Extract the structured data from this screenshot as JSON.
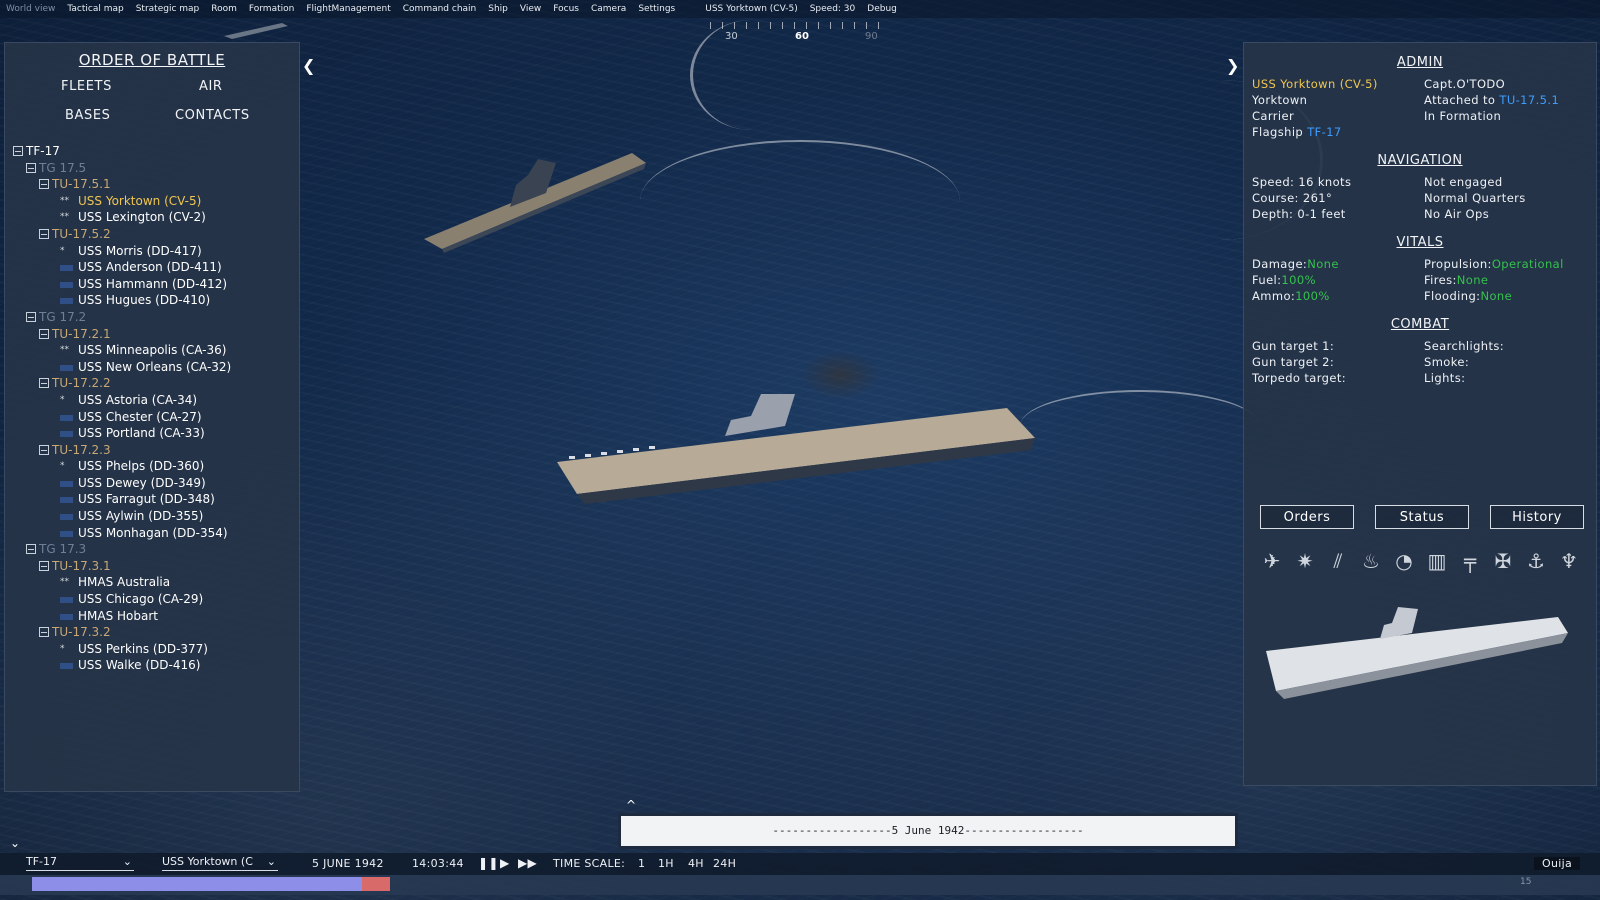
{
  "menu": {
    "items": [
      "World view",
      "Tactical map",
      "Strategic map",
      "Room",
      "Formation",
      "FlightManagement",
      "Command chain",
      "Ship",
      "View",
      "Focus",
      "Camera",
      "Settings"
    ],
    "status_ship": "USS Yorktown (CV-5)",
    "status_speed": "Speed: 30",
    "debug": "Debug"
  },
  "compass": {
    "labels": [
      "30",
      "60",
      "90"
    ]
  },
  "oob": {
    "title": "ORDER OF BATTLE",
    "tabs": [
      "FLEETS",
      "AIR",
      "BASES",
      "CONTACTS"
    ],
    "tree": [
      {
        "level": 0,
        "type": "tf",
        "label": "TF-17",
        "box": true
      },
      {
        "level": 1,
        "type": "tg",
        "label": "TG 17.5",
        "box": true
      },
      {
        "level": 2,
        "type": "tu",
        "label": "TU-17.5.1",
        "box": true
      },
      {
        "level": 3,
        "type": "ship",
        "label": "USS Yorktown (CV-5)",
        "flag": "**",
        "selected": true
      },
      {
        "level": 3,
        "type": "ship",
        "label": "USS Lexington (CV-2)",
        "flag": "**"
      },
      {
        "level": 2,
        "type": "tu",
        "label": "TU-17.5.2",
        "box": true
      },
      {
        "level": 3,
        "type": "ship",
        "label": "USS Morris (DD-417)",
        "flag": "*"
      },
      {
        "level": 3,
        "type": "ship",
        "label": "USS Anderson (DD-411)",
        "flag": "bar"
      },
      {
        "level": 3,
        "type": "ship",
        "label": "USS Hammann (DD-412)",
        "flag": "bar"
      },
      {
        "level": 3,
        "type": "ship",
        "label": "USS Hugues (DD-410)",
        "flag": "bar"
      },
      {
        "level": 1,
        "type": "tg",
        "label": "TG 17.2",
        "box": true
      },
      {
        "level": 2,
        "type": "tu",
        "label": "TU-17.2.1",
        "box": true
      },
      {
        "level": 3,
        "type": "ship",
        "label": "USS Minneapolis (CA-36)",
        "flag": "**"
      },
      {
        "level": 3,
        "type": "ship",
        "label": "USS New Orleans (CA-32)",
        "flag": "bar"
      },
      {
        "level": 2,
        "type": "tu",
        "label": "TU-17.2.2",
        "box": true
      },
      {
        "level": 3,
        "type": "ship",
        "label": "USS Astoria (CA-34)",
        "flag": "*"
      },
      {
        "level": 3,
        "type": "ship",
        "label": "USS Chester (CA-27)",
        "flag": "bar"
      },
      {
        "level": 3,
        "type": "ship",
        "label": "USS Portland (CA-33)",
        "flag": "bar"
      },
      {
        "level": 2,
        "type": "tu",
        "label": "TU-17.2.3",
        "box": true
      },
      {
        "level": 3,
        "type": "ship",
        "label": "USS Phelps (DD-360)",
        "flag": "*"
      },
      {
        "level": 3,
        "type": "ship",
        "label": "USS Dewey (DD-349)",
        "flag": "bar"
      },
      {
        "level": 3,
        "type": "ship",
        "label": "USS Farragut (DD-348)",
        "flag": "bar"
      },
      {
        "level": 3,
        "type": "ship",
        "label": "USS Aylwin (DD-355)",
        "flag": "bar"
      },
      {
        "level": 3,
        "type": "ship",
        "label": "USS Monhagan (DD-354)",
        "flag": "bar"
      },
      {
        "level": 1,
        "type": "tg",
        "label": "TG 17.3",
        "box": true
      },
      {
        "level": 2,
        "type": "tu",
        "label": "TU-17.3.1",
        "box": true
      },
      {
        "level": 3,
        "type": "ship",
        "label": "HMAS Australia",
        "flag": "**"
      },
      {
        "level": 3,
        "type": "ship",
        "label": "USS Chicago (CA-29)",
        "flag": "bar"
      },
      {
        "level": 3,
        "type": "ship",
        "label": "HMAS Hobart",
        "flag": "bar"
      },
      {
        "level": 2,
        "type": "tu",
        "label": "TU-17.3.2",
        "box": true
      },
      {
        "level": 3,
        "type": "ship",
        "label": "USS Perkins (DD-377)",
        "flag": "*"
      },
      {
        "level": 3,
        "type": "ship",
        "label": "USS Walke (DD-416)",
        "flag": "bar"
      }
    ]
  },
  "details": {
    "admin_title": "ADMIN",
    "ship_name": "USS Yorktown (CV-5)",
    "class_name": "Yorktown",
    "ship_type": "Carrier",
    "flagship_label": "Flagship",
    "flagship_value": "TF-17",
    "captain": "Capt.O'TODO",
    "attached_label": "Attached to",
    "attached_value": "TU-17.5.1",
    "formation": "In Formation",
    "nav_title": "NAVIGATION",
    "speed": "Speed: 16 knots",
    "course": "Course: 261°",
    "depth": "Depth: 0-1 feet",
    "engaged": "Not engaged",
    "quarters": "Normal Quarters",
    "air_ops": "No Air Ops",
    "vitals_title": "VITALS",
    "damage_label": "Damage:",
    "damage_value": "None",
    "fuel_label": "Fuel:",
    "fuel_value": "100%",
    "ammo_label": "Ammo:",
    "ammo_value": "100%",
    "propulsion_label": "Propulsion:",
    "propulsion_value": "Operational",
    "fires_label": "Fires:",
    "fires_value": "None",
    "flooding_label": "Flooding:",
    "flooding_value": "None",
    "combat_title": "COMBAT",
    "gun1": "Gun target 1:",
    "gun2": "Gun target 2:",
    "torpedo": "Torpedo target:",
    "searchlights": "Searchlights:",
    "smoke": "Smoke:",
    "lights": "Lights:",
    "buttons": [
      "Orders",
      "Status",
      "History"
    ],
    "icons": [
      "aircraft-icon",
      "catapult-icon",
      "missile-icon",
      "factory-icon",
      "radar-icon",
      "barrier-icon",
      "crane-icon",
      "tools-icon",
      "anchor-icon",
      "fire-icon"
    ]
  },
  "log": {
    "text": "------------------5 June 1942------------------"
  },
  "bottom": {
    "group_select": "TF-17",
    "ship_select": "USS Yorktown (C",
    "date": "5 JUNE 1942",
    "time": "14:03:44",
    "timescale_label": "TIME SCALE:",
    "timescales": [
      "1",
      "1H",
      "4H",
      "24H"
    ],
    "ouija": "Ouija",
    "timeline_value": "15"
  },
  "colors": {
    "selected": "#f0c650",
    "link": "#3d9dff",
    "ok": "#34c24c",
    "unit": "#c8a874",
    "group": "#6e7f96"
  }
}
